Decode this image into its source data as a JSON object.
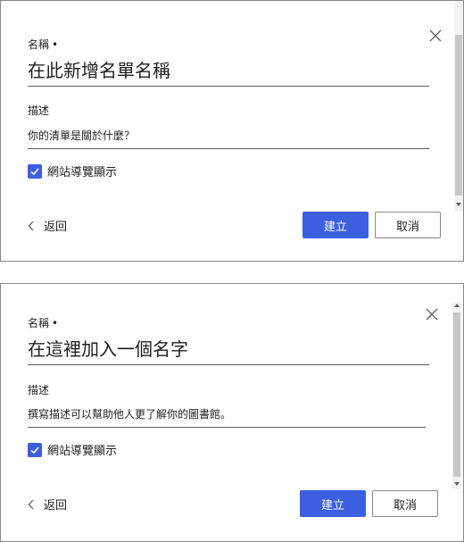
{
  "dialogs": [
    {
      "name_label": "名稱",
      "required_mark": "•",
      "name_value": "在此新增名單名稱",
      "description_label": "描述",
      "description_value": "你的清單是關於什麼？",
      "nav_checkbox_label": "網站導覽顯示",
      "nav_checkbox_checked": true,
      "back_label": "返回",
      "create_label": "建立",
      "cancel_label": "取消"
    },
    {
      "name_label": "名稱",
      "required_mark": "•",
      "name_value": "在這裡加入一個名字",
      "description_label": "描述",
      "description_value": "撰寫描述可以幫助他人更了解你的圖書館。",
      "nav_checkbox_label": "網站導覽顯示",
      "nav_checkbox_checked": true,
      "back_label": "返回",
      "create_label": "建立",
      "cancel_label": "取消"
    }
  ],
  "colors": {
    "accent": "#3b5fe0",
    "border": "#8a8886",
    "text": "#201f1e"
  },
  "icons": [
    "close-icon",
    "chevron-left-icon",
    "checkmark-icon"
  ]
}
